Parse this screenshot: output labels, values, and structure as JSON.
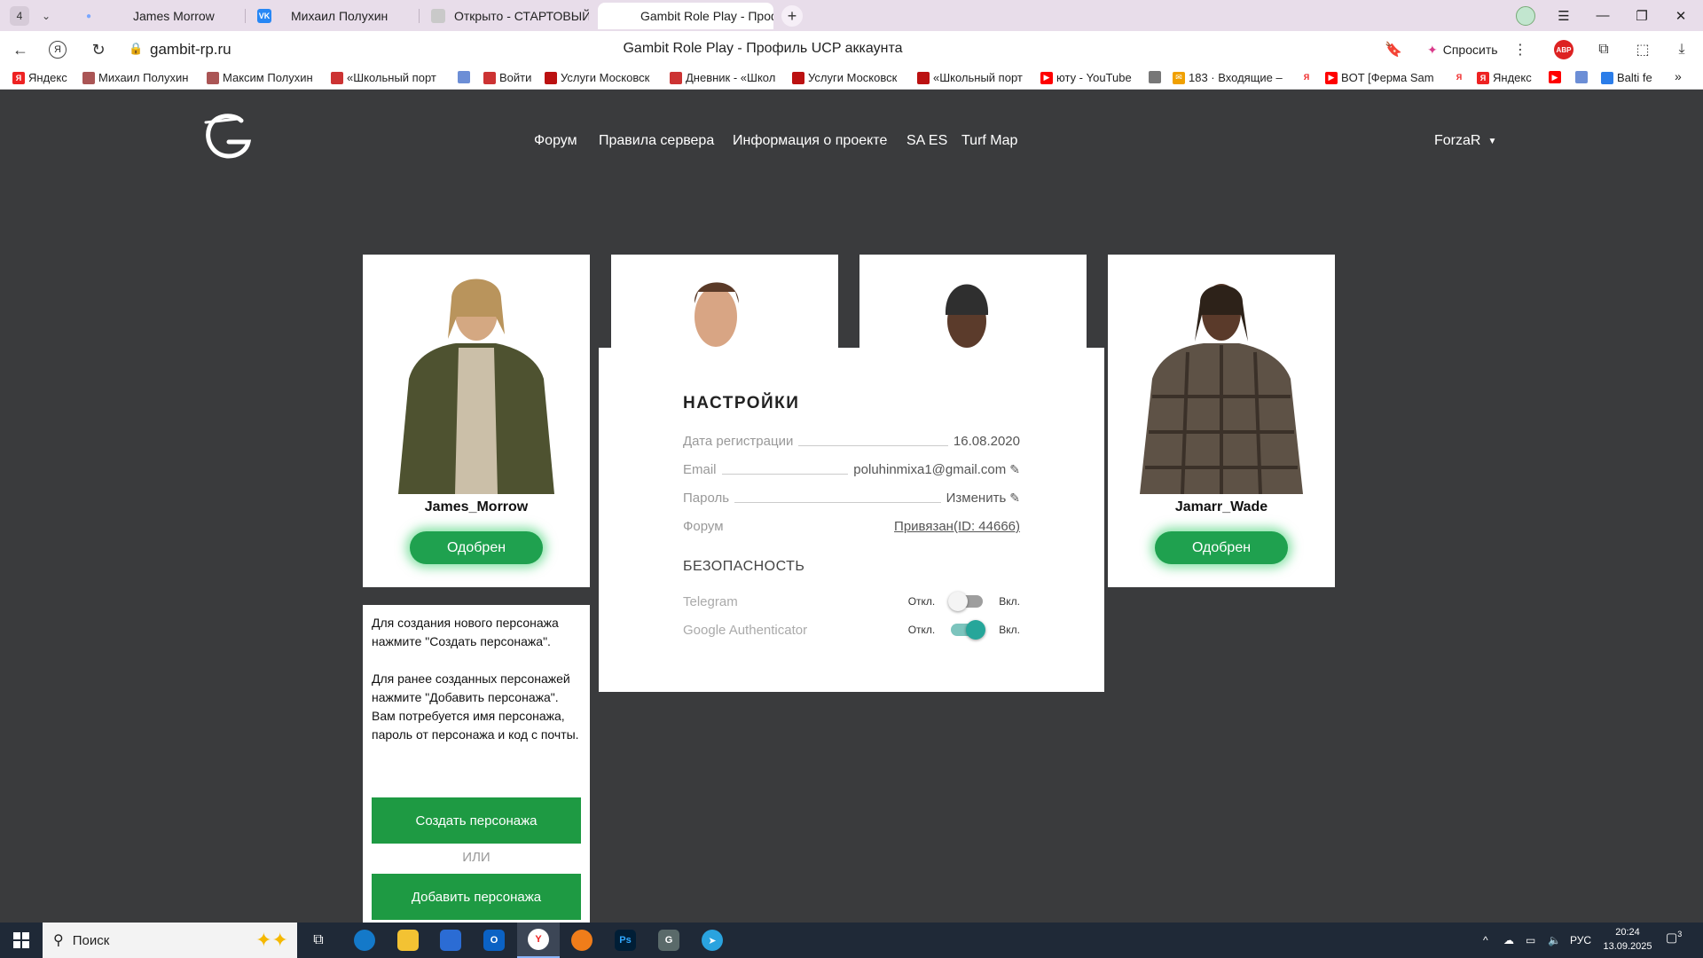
{
  "browser": {
    "tab_count": "4",
    "tabs": [
      {
        "title": "James Morrow"
      },
      {
        "title": "Михаил Полухин"
      },
      {
        "title": "Открыто - СТАРТОВЫЙ С"
      },
      {
        "title": "Gambit Role Play - Проф"
      }
    ],
    "url": "gambit-rp.ru",
    "page_title": "Gambit Role Play - Профиль UCP аккаунта",
    "ask_label": "Спросить",
    "abp_label": "ABP",
    "bookmarks": [
      "Яндекс",
      "Михаил Полухин",
      "Максим Полухин",
      "«Школьный порт",
      "",
      "Войти",
      "Услуги Московск",
      "Дневник - «Школ",
      "Услуги Московск",
      "«Школьный порт",
      "юту - YouTube",
      "",
      "183 · Входящие –",
      "",
      "BOT [Ферма Sam",
      "",
      "Яндекс",
      "",
      "",
      "Balti fe"
    ]
  },
  "site": {
    "nav": [
      "Форум",
      "Правила сервера",
      "Информация о проекте",
      "SA ES",
      "Turf Map"
    ],
    "user": "ForzaR"
  },
  "characters": [
    {
      "name": "James_Morrow",
      "status": "Одобрен"
    },
    {
      "name": "Jamarr_Wade",
      "status": "Одобрен"
    }
  ],
  "info": {
    "text1": "Для создания нового персонажа нажмите \"Создать персонажа\".",
    "text2": "Для ранее созданных персонажей нажмите \"Добавить персонажа\". Вам потребуется имя персонажа, пароль от персонажа и код с почты.",
    "create_label": "Создать персонажа",
    "or_label": "ИЛИ",
    "add_label": "Добавить персонажа"
  },
  "settings": {
    "title": "НАСТРОЙКИ",
    "rows": [
      {
        "label": "Дата регистрации",
        "value": "16.08.2020"
      },
      {
        "label": "Email",
        "value": "poluhinmixa1@gmail.com"
      },
      {
        "label": "Пароль",
        "value": "Изменить"
      },
      {
        "label": "Форум",
        "value": "Привязан(ID: 44666)"
      }
    ],
    "security_title": "БЕЗОПАСНОСТЬ",
    "toggles": [
      {
        "label": "Telegram",
        "off": "Откл.",
        "on": "Вкл.",
        "enabled": false
      },
      {
        "label": "Google Authenticator",
        "off": "Откл.",
        "on": "Вкл.",
        "enabled": true
      }
    ]
  },
  "taskbar": {
    "search_placeholder": "Поиск",
    "lang": "РУС",
    "time": "20:24",
    "date": "13.09.2025",
    "notif_count": "3"
  }
}
